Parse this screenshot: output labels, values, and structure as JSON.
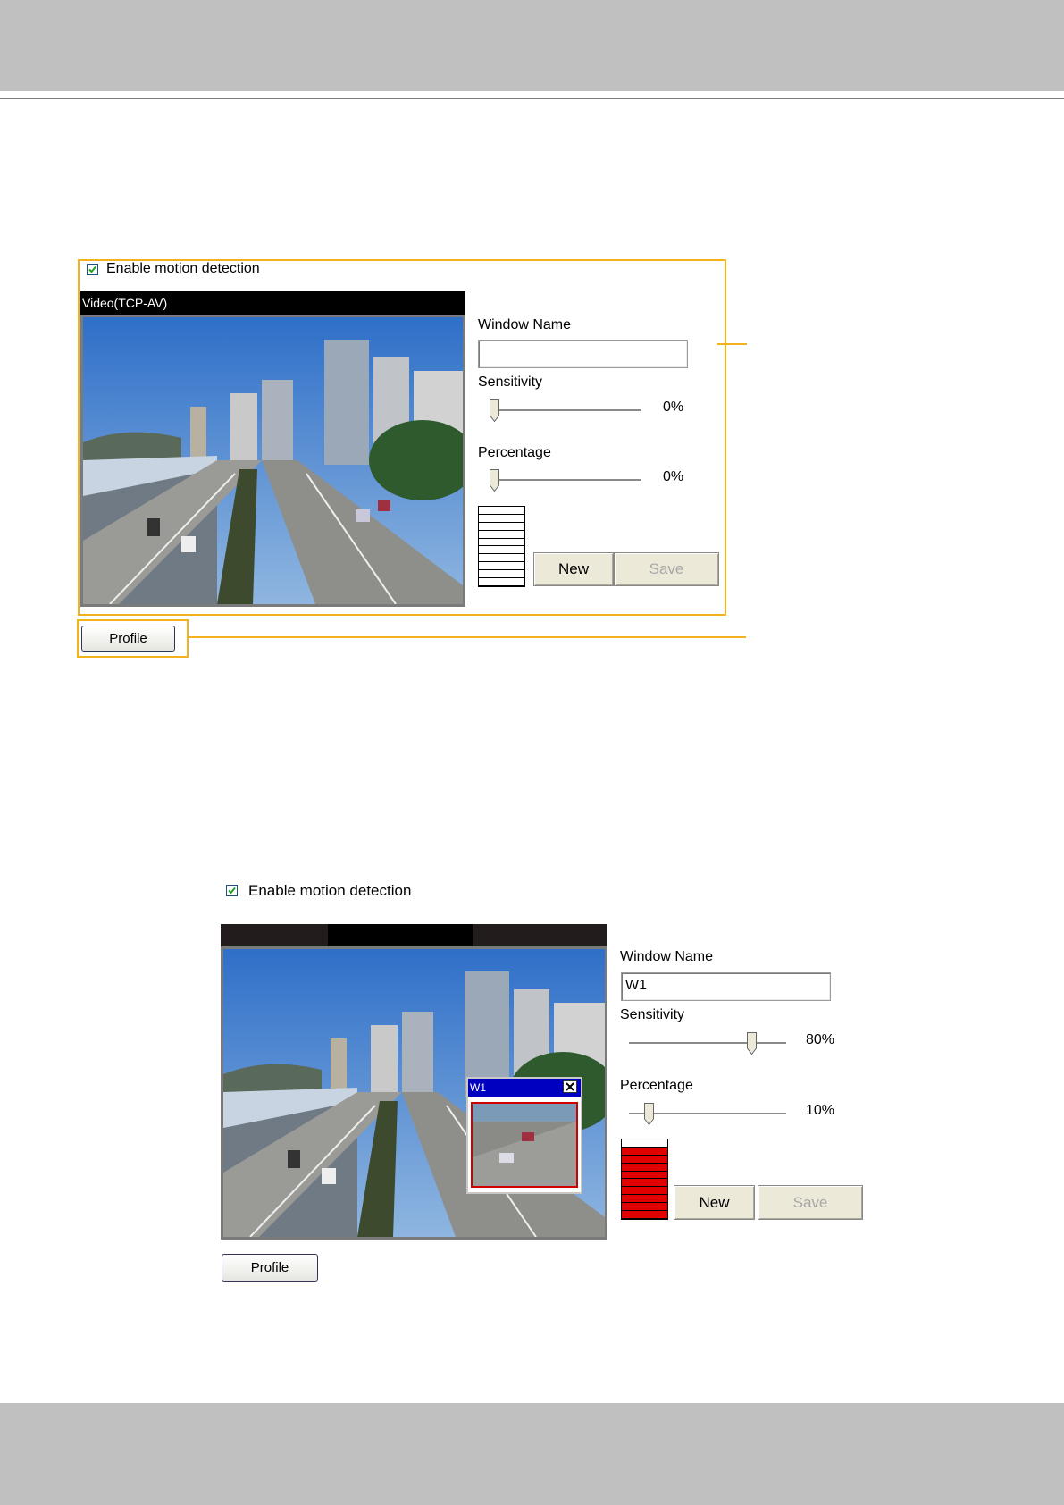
{
  "panel1": {
    "enable_label": "Enable motion detection",
    "enable_checked": true,
    "video_title": "Video(TCP-AV)",
    "window_name_label": "Window Name",
    "window_name_value": "",
    "sensitivity_label": "Sensitivity",
    "sensitivity_value": "0%",
    "sensitivity_level": 0,
    "percentage_label": "Percentage",
    "percentage_value": "0%",
    "percentage_level": 0,
    "meter_lit_fraction": 0,
    "new_label": "New",
    "save_label": "Save",
    "profile_label": "Profile"
  },
  "panel2": {
    "enable_label": "Enable motion detection",
    "enable_checked": true,
    "window_name_label": "Window Name",
    "window_name_value": "W1",
    "sensitivity_label": "Sensitivity",
    "sensitivity_value": "80%",
    "sensitivity_level": 0.8,
    "percentage_label": "Percentage",
    "percentage_value": "10%",
    "percentage_level": 0.1,
    "meter_lit_fraction": 0.9,
    "motion_window_title": "W1",
    "new_label": "New",
    "save_label": "Save",
    "profile_label": "Profile"
  },
  "colors": {
    "callout": "#f2b21c",
    "motion_window_title_bar": "#0000c0",
    "meter_active": "#e00000",
    "header_band": "#c0c0c0"
  }
}
